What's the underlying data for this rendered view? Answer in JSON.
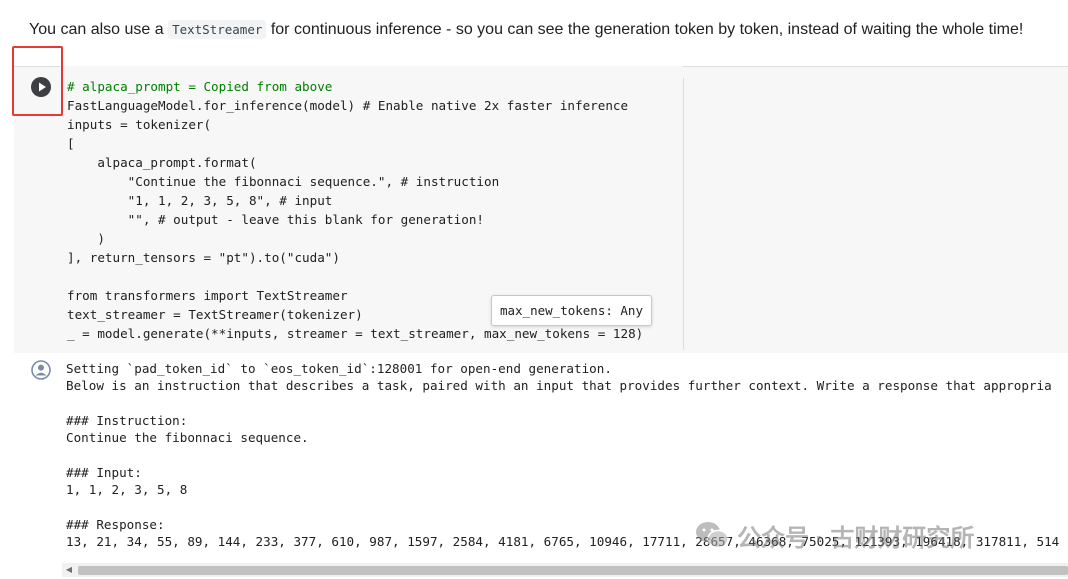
{
  "intro": {
    "before": "You can also use a ",
    "code": "TextStreamer",
    "after": " for continuous inference - so you can see the generation token by token, instead of waiting the whole time!"
  },
  "cell": {
    "run_button_icon": "play-circle-icon",
    "code_lines": [
      "# alpaca_prompt = Copied from above",
      "FastLanguageModel.for_inference(model) # Enable native 2x faster inference",
      "inputs = tokenizer(",
      "[",
      "    alpaca_prompt.format(",
      "        \"Continue the fibonnaci sequence.\", # instruction",
      "        \"1, 1, 2, 3, 5, 8\", # input",
      "        \"\", # output - leave this blank for generation!",
      "    )",
      "], return_tensors = \"pt\").to(\"cuda\")",
      "",
      "from transformers import TextStreamer",
      "text_streamer = TextStreamer(tokenizer)",
      "_ = model.generate(**inputs, streamer = text_streamer, max_new_tokens = 128)"
    ],
    "tooltip": "max_new_tokens: Any"
  },
  "output": {
    "icon": "output-status-icon",
    "lines": [
      "Setting `pad_token_id` to `eos_token_id`:128001 for open-end generation.",
      "Below is an instruction that describes a task, paired with an input that provides further context. Write a response that appropria",
      "",
      "### Instruction:",
      "Continue the fibonnaci sequence.",
      "",
      "### Input:",
      "1, 1, 2, 3, 5, 8",
      "",
      "### Response:",
      "13, 21, 34, 55, 89, 144, 233, 377, 610, 987, 1597, 2584, 4181, 6765, 10946, 17711, 28657, 46368, 75025, 121393, 196418, 317811, 514"
    ]
  },
  "watermark": {
    "text": "公众号 · 古财财研究所",
    "icon": "wechat-icon"
  },
  "colors": {
    "highlight_border": "#e53935",
    "comment": "#008000",
    "string": "#a31515",
    "keyword": "#7928a1"
  }
}
